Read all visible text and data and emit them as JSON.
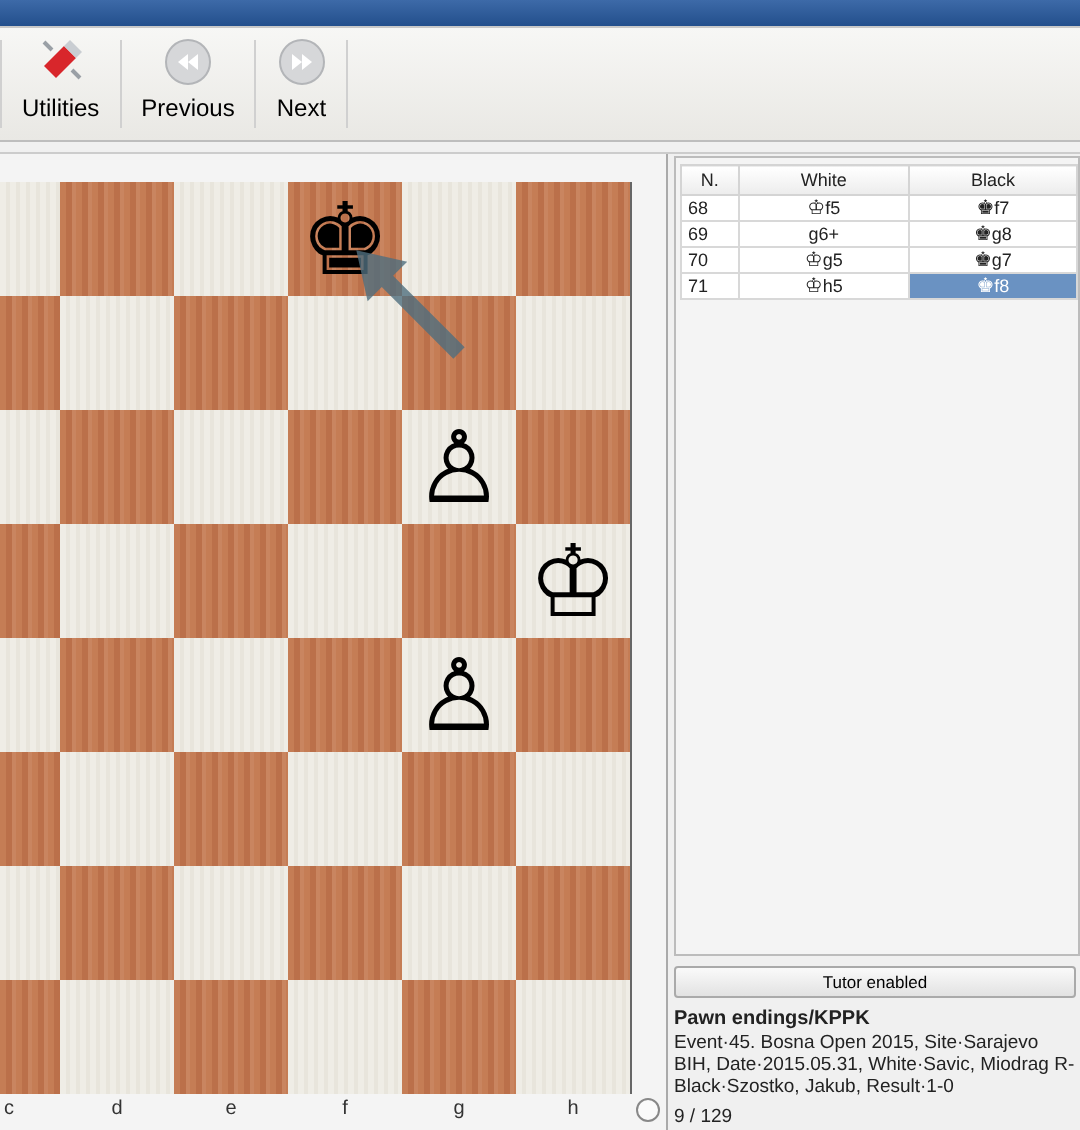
{
  "toolbar": [
    {
      "label": "Utilities",
      "kind": "utilities"
    },
    {
      "label": "Previous",
      "kind": "previous"
    },
    {
      "label": "Next",
      "kind": "next"
    }
  ],
  "board": {
    "files": [
      "c",
      "d",
      "e",
      "f",
      "g",
      "h"
    ],
    "ranks": [
      [
        {
          "kind": "empty"
        },
        {
          "kind": "empty"
        },
        {
          "kind": "empty"
        },
        {
          "kind": "arrow-end",
          "glyph": "♚"
        },
        {
          "kind": "empty"
        },
        {
          "kind": "empty"
        }
      ],
      [
        {
          "kind": "empty"
        },
        {
          "kind": "empty"
        },
        {
          "kind": "empty"
        },
        {
          "kind": "empty"
        },
        {
          "kind": "arrow-start"
        },
        {
          "kind": "empty"
        }
      ],
      [
        {
          "kind": "empty"
        },
        {
          "kind": "empty"
        },
        {
          "kind": "empty"
        },
        {
          "kind": "empty"
        },
        {
          "kind": "piece",
          "glyph": "♙"
        },
        {
          "kind": "empty"
        }
      ],
      [
        {
          "kind": "empty"
        },
        {
          "kind": "empty"
        },
        {
          "kind": "empty"
        },
        {
          "kind": "empty"
        },
        {
          "kind": "empty"
        },
        {
          "kind": "piece",
          "glyph": "♔"
        }
      ],
      [
        {
          "kind": "empty"
        },
        {
          "kind": "empty"
        },
        {
          "kind": "empty"
        },
        {
          "kind": "empty"
        },
        {
          "kind": "piece",
          "glyph": "♙"
        },
        {
          "kind": "empty"
        }
      ],
      [
        {
          "kind": "empty"
        },
        {
          "kind": "empty"
        },
        {
          "kind": "empty"
        },
        {
          "kind": "empty"
        },
        {
          "kind": "empty"
        },
        {
          "kind": "empty"
        }
      ],
      [
        {
          "kind": "empty"
        },
        {
          "kind": "empty"
        },
        {
          "kind": "empty"
        },
        {
          "kind": "empty"
        },
        {
          "kind": "empty"
        },
        {
          "kind": "empty"
        }
      ],
      [
        {
          "kind": "empty"
        },
        {
          "kind": "empty"
        },
        {
          "kind": "empty"
        },
        {
          "kind": "empty"
        },
        {
          "kind": "empty"
        },
        {
          "kind": "empty"
        }
      ]
    ],
    "black_to_move": false
  },
  "moves": {
    "columns": [
      "N.",
      "White",
      "Black"
    ],
    "rows": [
      {
        "number": "68",
        "white": {
          "figure": "♔",
          "move": "f5",
          "selected": false
        },
        "black": {
          "figure": "♚",
          "move": "f7",
          "selected": false
        }
      },
      {
        "number": "69",
        "white": {
          "move": "g6+",
          "selected": false
        },
        "black": {
          "figure": "♚",
          "move": "g8",
          "selected": false
        }
      },
      {
        "number": "70",
        "white": {
          "figure": "♔",
          "move": "g5",
          "selected": false
        },
        "black": {
          "figure": "♚",
          "move": "g7",
          "selected": false
        }
      },
      {
        "number": "71",
        "white": {
          "figure": "♔",
          "move": "h5",
          "selected": false
        },
        "black": {
          "figure": "♚",
          "move": "f8",
          "selected": true
        }
      }
    ]
  },
  "tutor_button": "Tutor enabled",
  "game": {
    "title": "Pawn endings/KPPK",
    "details": "Event·45. Bosna Open 2015, Site·Sarajevo BIH, Date·2015.05.31, White·Savic, Miodrag R-Black·Szostko, Jakub, Result·1-0"
  },
  "counter": "9 / 129"
}
